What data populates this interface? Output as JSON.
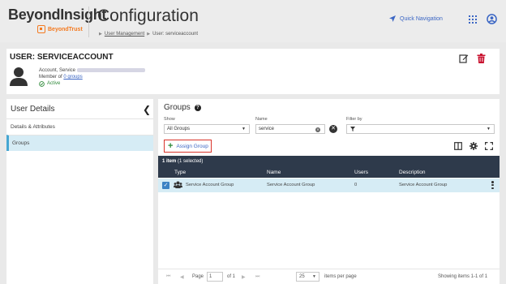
{
  "header": {
    "brand": "BeyondInsight",
    "brand_sub": "BeyondTrust",
    "title": "Configuration",
    "breadcrumb": {
      "link": "User Management",
      "current": "User: serviceaccount"
    },
    "quick_nav": "Quick Navigation"
  },
  "user_card": {
    "title": "USER: SERVICEACCOUNT",
    "name_line": "Account, Service",
    "member_prefix": "Member of",
    "groups_link": "0 groups",
    "status": "Active"
  },
  "sidebar": {
    "title": "User Details",
    "items": [
      {
        "label": "Details & Attributes"
      },
      {
        "label": "Groups"
      }
    ]
  },
  "groups": {
    "title": "Groups",
    "show_label": "Show",
    "show_value": "All Groups",
    "name_label": "Name",
    "name_value": "service",
    "filter_label": "Filter by",
    "assign_label": "Assign Group",
    "count": "1 item",
    "selected": "(1 selected)",
    "columns": [
      "Type",
      "Name",
      "Users",
      "Description"
    ],
    "rows": [
      {
        "type": "Service Account Group",
        "name": "Service Account Group",
        "users": "0",
        "description": "Service Account Group"
      }
    ]
  },
  "pager": {
    "page_label": "Page",
    "page_value": "1",
    "of_label": "of 1",
    "per_page": "25",
    "per_page_label": "items per page",
    "showing": "Showing items 1-1 of 1"
  },
  "colors": {
    "accent": "#3b66c4",
    "header_dark": "#2e3a4b",
    "selected_row": "#d6ecf5",
    "danger": "#c8102e",
    "brand_orange": "#f47a20"
  }
}
